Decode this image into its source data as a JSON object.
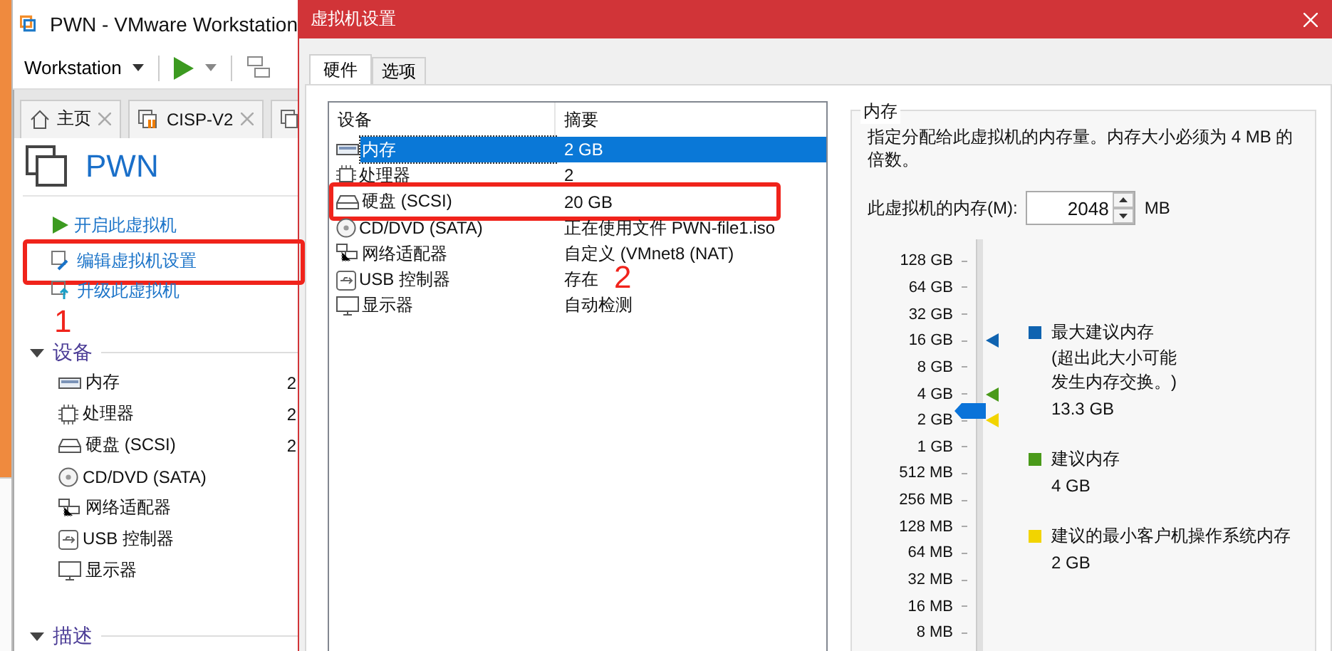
{
  "left_window": {
    "title": "PWN - VMware Workstation",
    "toolbar": {
      "menu": "Workstation"
    },
    "tabs": [
      {
        "label": "主页",
        "kind": "home",
        "selected": false
      },
      {
        "label": "CISP-V2",
        "kind": "vm",
        "selected": false
      }
    ],
    "vm_name": "PWN",
    "commands": [
      {
        "label": "开启此虚拟机",
        "kind": "power",
        "annotated": false
      },
      {
        "label": "编辑虚拟机设置",
        "kind": "edit",
        "annotated": true
      },
      {
        "label": "升级此虚拟机",
        "kind": "upgrade",
        "annotated": false
      }
    ],
    "devices_section": {
      "title": "设备",
      "expanded": true,
      "items": [
        {
          "name": "内存",
          "value": "2",
          "kind": "memory"
        },
        {
          "name": "处理器",
          "value": "2",
          "kind": "cpu"
        },
        {
          "name": "硬盘 (SCSI)",
          "value": "2",
          "kind": "disk"
        },
        {
          "name": "CD/DVD (SATA)",
          "kind": "cd"
        },
        {
          "name": "网络适配器",
          "kind": "network"
        },
        {
          "name": "USB 控制器",
          "kind": "usb"
        },
        {
          "name": "显示器",
          "kind": "display"
        }
      ]
    },
    "description_section": {
      "title": "描述",
      "expanded": true
    }
  },
  "annotations": [
    {
      "label": "1"
    },
    {
      "label": "2"
    }
  ],
  "dialog": {
    "title": "虚拟机设置",
    "tabs": [
      {
        "label": "硬件",
        "selected": true
      },
      {
        "label": "选项",
        "selected": false
      }
    ],
    "table": {
      "columns": [
        "设备",
        "摘要"
      ],
      "rows": [
        {
          "device": "内存",
          "summary": "2 GB",
          "kind": "memory",
          "selected": true,
          "annotated": false
        },
        {
          "device": "处理器",
          "summary": "2",
          "kind": "cpu",
          "selected": false,
          "annotated": false
        },
        {
          "device": "硬盘 (SCSI)",
          "summary": "20 GB",
          "kind": "disk",
          "selected": false,
          "annotated": true
        },
        {
          "device": "CD/DVD (SATA)",
          "summary": "正在使用文件 PWN-file1.iso",
          "kind": "cd",
          "selected": false,
          "annotated": false
        },
        {
          "device": "网络适配器",
          "summary": "自定义 (VMnet8 (NAT)",
          "kind": "network",
          "selected": false,
          "annotated": false
        },
        {
          "device": "USB 控制器",
          "summary": "存在",
          "kind": "usb",
          "selected": false,
          "annotated": false
        },
        {
          "device": "显示器",
          "summary": "自动检测",
          "kind": "display",
          "selected": false,
          "annotated": false
        }
      ]
    },
    "memory": {
      "title": "内存",
      "description": "指定分配给此虚拟机的内存量。内存大小必须为 4 MB 的倍数。",
      "field_label": "此虚拟机的内存(M):",
      "value": "2048",
      "unit": "MB",
      "slider": {
        "level": 0.571,
        "ticks": [
          {
            "label": "128 GB"
          },
          {
            "label": "64 GB"
          },
          {
            "label": "32 GB"
          },
          {
            "label": "16 GB",
            "color": "#0f63b0"
          },
          {
            "label": "8 GB"
          },
          {
            "label": "4 GB",
            "color": "#4a9a1a"
          },
          {
            "label": "2 GB",
            "color": "#f2d400"
          },
          {
            "label": "1 GB"
          },
          {
            "label": "512 MB"
          },
          {
            "label": "256 MB"
          },
          {
            "label": "128 MB"
          },
          {
            "label": "64 MB"
          },
          {
            "label": "32 MB"
          },
          {
            "label": "16 MB"
          },
          {
            "label": "8 MB"
          }
        ]
      },
      "legend": [
        {
          "label": "最大建议内存",
          "note": "(超出此大小可能发生内存交换。)",
          "value": "13.3 GB",
          "color": "#0f63b0"
        },
        {
          "label": "建议内存",
          "value": "4 GB",
          "color": "#4a9a1a"
        },
        {
          "label": "建议的最小客户机操作系统内存",
          "value": "2 GB",
          "color": "#f2d400"
        }
      ]
    }
  }
}
